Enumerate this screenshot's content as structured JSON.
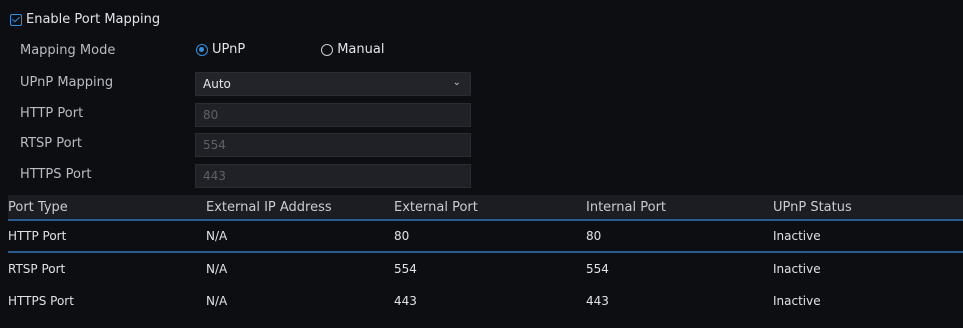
{
  "enable": {
    "label": "Enable Port Mapping",
    "checked": true
  },
  "mapping_mode": {
    "label": "Mapping Mode",
    "options": [
      "UPnP",
      "Manual"
    ],
    "selected": "UPnP"
  },
  "upnp_mapping": {
    "label": "UPnP Mapping",
    "value": "Auto"
  },
  "http_port": {
    "label": "HTTP Port",
    "value": "80"
  },
  "rtsp_port": {
    "label": "RTSP Port",
    "value": "554"
  },
  "https_port": {
    "label": "HTTPS Port",
    "value": "443"
  },
  "table": {
    "headers": [
      "Port Type",
      "External IP Address",
      "External Port",
      "Internal Port",
      "UPnP Status"
    ],
    "rows": [
      [
        "HTTP Port",
        "N/A",
        "80",
        "80",
        "Inactive"
      ],
      [
        "RTSP Port",
        "N/A",
        "554",
        "554",
        "Inactive"
      ],
      [
        "HTTPS Port",
        "N/A",
        "443",
        "443",
        "Inactive"
      ]
    ]
  },
  "colors": {
    "accent": "#2f8fe0",
    "divider": "#2d5a93",
    "background": "#0d0e12"
  }
}
